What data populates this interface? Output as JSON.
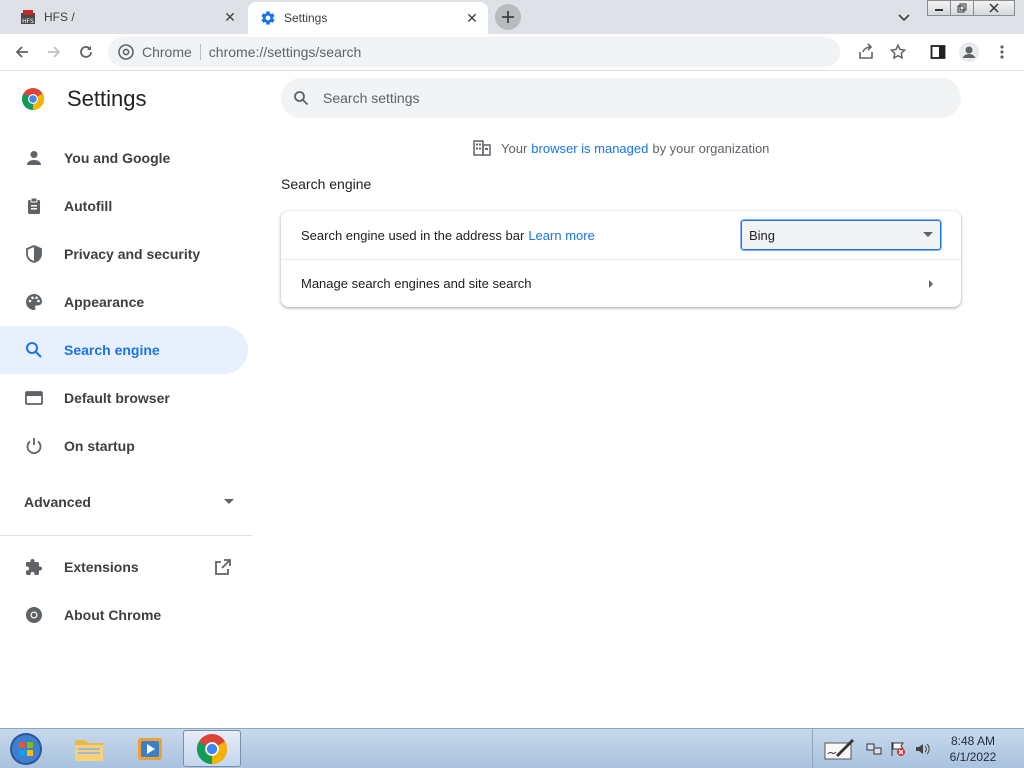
{
  "tabs": [
    {
      "title": "HFS /",
      "active": false
    },
    {
      "title": "Settings",
      "active": true
    }
  ],
  "toolbar": {
    "site_chip": "Chrome",
    "url": "chrome://settings/search"
  },
  "app": {
    "title": "Settings"
  },
  "search": {
    "placeholder": "Search settings"
  },
  "sidebar": {
    "items": [
      {
        "label": "You and Google",
        "icon": "person-icon"
      },
      {
        "label": "Autofill",
        "icon": "clipboard-icon"
      },
      {
        "label": "Privacy and security",
        "icon": "shield-icon"
      },
      {
        "label": "Appearance",
        "icon": "palette-icon"
      },
      {
        "label": "Search engine",
        "icon": "search-icon",
        "active": true
      },
      {
        "label": "Default browser",
        "icon": "browser-window-icon"
      },
      {
        "label": "On startup",
        "icon": "power-icon"
      }
    ],
    "advanced_label": "Advanced",
    "extensions_label": "Extensions",
    "about_label": "About Chrome"
  },
  "managed_notice": {
    "prefix": "Your",
    "link": "browser is managed",
    "suffix": "by your organization"
  },
  "section": {
    "title": "Search engine",
    "row1_label": "Search engine used in the address bar",
    "row1_link": "Learn more",
    "selected_engine": "Bing",
    "row2_label": "Manage search engines and site search"
  },
  "taskbar": {
    "time": "8:48 AM",
    "date": "6/1/2022"
  },
  "colors": {
    "accent": "#1a73e8",
    "active_bg": "#e8f0fe",
    "tabstrip": "#dee1e6"
  }
}
